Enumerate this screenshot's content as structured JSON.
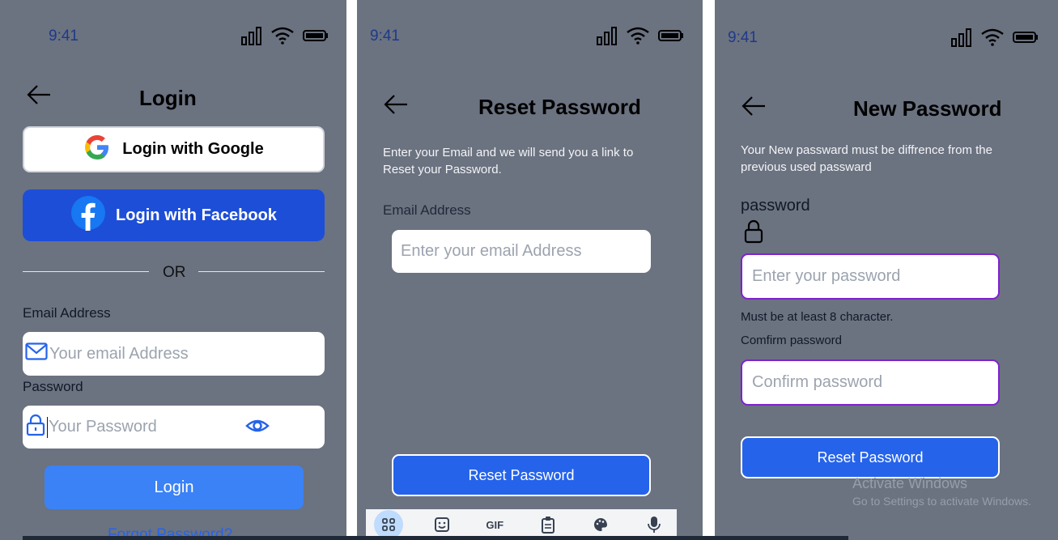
{
  "colors": {
    "phone_bg": "#6b7280",
    "primary": "#2563eb",
    "facebook": "#1d4ed8",
    "focus_border": "#7e22ce"
  },
  "status": {
    "time": "9:41",
    "icons": [
      "signal-icon",
      "wifi-icon",
      "battery-icon"
    ]
  },
  "login": {
    "title": "Login",
    "google_label": "Login with Google",
    "facebook_label": "Login with Facebook",
    "or_label": "OR",
    "email_label": "Email Address",
    "email_placeholder": "Your email Address",
    "password_label": "Password",
    "password_placeholder": "Your Password",
    "login_label": "Login",
    "forgot_label": "Forgot Password?"
  },
  "reset": {
    "title": "Reset Password",
    "description": "Enter your Email and we will send you a link to Reset your Password.",
    "email_label": "Email Address",
    "email_placeholder": "Enter your email Address",
    "button_label": "Reset Password",
    "keyboard": {
      "gif_label": "GIF",
      "icons": [
        "apps-icon",
        "sticker-icon",
        "gif-icon",
        "clipboard-icon",
        "palette-icon",
        "mic-icon"
      ]
    }
  },
  "new_password": {
    "title": "New Password",
    "description": "Your New passward must be diffrence from the previous used passward",
    "password_label": "password",
    "password_placeholder": "Enter your password",
    "hint": "Must be at least 8 character.",
    "confirm_label": "Comfirm password",
    "confirm_placeholder": "Confirm password",
    "button_label": "Reset Password"
  },
  "watermark": {
    "line1": "Activate Windows",
    "line2": "Go to Settings to activate Windows."
  }
}
